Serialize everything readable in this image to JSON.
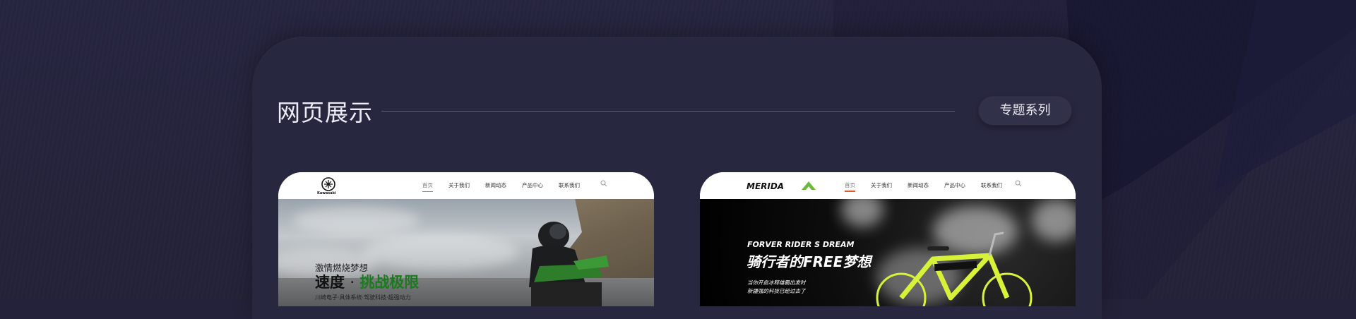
{
  "section": {
    "title": "网页展示",
    "series_button": "专题系列"
  },
  "cards": [
    {
      "brand": "Kawasaki",
      "nav": [
        "首页",
        "关于我们",
        "新闻动态",
        "产品中心",
        "联系我们"
      ],
      "active_nav": "首页",
      "hero": {
        "subtitle": "激情燃烧梦想",
        "title_main": "速度",
        "title_dot": "·",
        "title_accent": "挑战极限",
        "description": "川崎电子·具体系统·驾驶科技·超强动力"
      }
    },
    {
      "brand": "MERIDA",
      "nav": [
        "首页",
        "关于我们",
        "新闻动态",
        "产品中心",
        "联系我们"
      ],
      "active_nav": "首页",
      "hero": {
        "english": "FORVER RIDER S DREAM",
        "title": "骑行者的FREE梦想",
        "line1": "当你开启冰释雄霸出发时",
        "line2": "新疆强的科技已经过去了"
      }
    }
  ],
  "colors": {
    "background": "#23223a",
    "panel": "#282740",
    "accent_green": "#1a7a1e",
    "merida_green": "#6bb83a",
    "bike_yellow": "#d8f23a"
  }
}
